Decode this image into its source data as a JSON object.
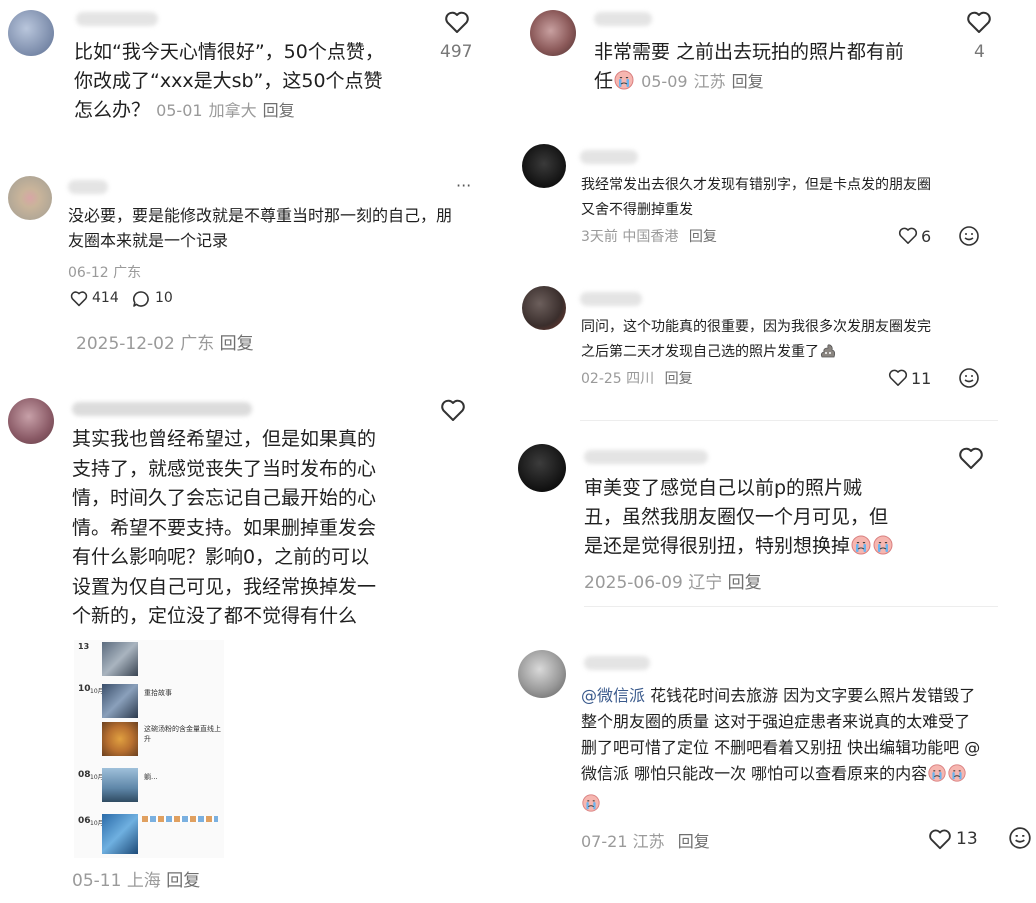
{
  "left": {
    "c1": {
      "text": "比如“我今天心情很好”，50个点赞，你改成了“xxx是大sb”，这50个点赞怎么办？",
      "line1": "比如“我今天心情很好”，50个点赞，",
      "line2": "你改成了“xxx是大sb”，这50个点赞",
      "line3": "怎么办？",
      "date": "05-01",
      "loc": "加拿大",
      "reply": "回复",
      "likes": "497"
    },
    "c2": {
      "line1": "没必要，要是能修改就是不尊重当时那一刻的自己，朋",
      "line2": "友圈本来就是一个记录",
      "date_loc": "06-12 广东",
      "likes": "414",
      "comments": "10",
      "more": "···",
      "footer_date": "2025-12-02",
      "footer_loc": "广东",
      "reply": "回复"
    },
    "c3": {
      "line1": "其实我也曾经希望过，但是如果真的",
      "line2": "支持了，就感觉丧失了当时发布的心",
      "line3": "情，时间久了会忘记自己最开始的心",
      "line4": "情。希望不要支持。如果删掉重发会",
      "line5": "有什么影响呢？影响0，之前的可以",
      "line6": "设置为仅自己可见，我经常换掉发一",
      "line7": "个新的，定位没了都不觉得有什么",
      "date": "05-11",
      "loc": "上海",
      "reply": "回复",
      "thumb": {
        "d1": "13",
        "d2": "10",
        "d2_m": "10月",
        "d2_p": "重拾故事",
        "d2_c": "这碗汤粉的含金量直线上升",
        "d3": "08",
        "d3_m": "10月",
        "d3_p": "躺...",
        "d4": "06",
        "d4_m": "10月"
      }
    }
  },
  "right": {
    "c1": {
      "line1": "非常需要 之前出去玩拍的照片都有前",
      "line2": "任",
      "date": "05-09",
      "loc": "江苏",
      "reply": "回复",
      "likes": "4"
    },
    "c2": {
      "line1": "我经常发出去很久才发现有错别字，但是卡点发的朋友圈",
      "line2": "又舍不得删掉重发",
      "date": "3天前",
      "loc": "中国香港",
      "reply": "回复",
      "likes": "6"
    },
    "c3": {
      "line1": "同问，这个功能真的很重要，因为我很多次发朋友圈发完",
      "line2": "之后第二天才发现自己选的照片发重了",
      "date": "02-25",
      "loc": "四川",
      "reply": "回复",
      "likes": "11"
    },
    "c4": {
      "line1": "审美变了感觉自己以前p的照片贼",
      "line2": "丑，虽然我朋友圈仅一个月可见，但",
      "line3": "是还是觉得很别扭，特别想换掉",
      "date": "2025-06-09",
      "loc": "辽宁",
      "reply": "回复"
    },
    "c5": {
      "mention": "@微信派",
      "line1_rest": " 花钱花时间去旅游 因为文字要么照片发错毁了",
      "line2": "整个朋友圈的质量 这对于强迫症患者来说真的太难受了",
      "line3": "删了吧可惜了定位 不删吧看着又别扭 快出编辑功能吧 @",
      "line4": "微信派  哪怕只能改一次 哪怕可以查看原来的内容",
      "date": "07-21",
      "loc": "江苏",
      "reply": "回复",
      "likes": "13"
    }
  },
  "colors": {
    "meta": "#9a9a9a",
    "mention": "#3a5a8c",
    "text": "#1f1f1f",
    "icon": "#333333"
  },
  "icons": [
    "heart-icon",
    "comment-icon",
    "more-icon",
    "smile-icon",
    "crying-emoji",
    "poop-emoji"
  ]
}
